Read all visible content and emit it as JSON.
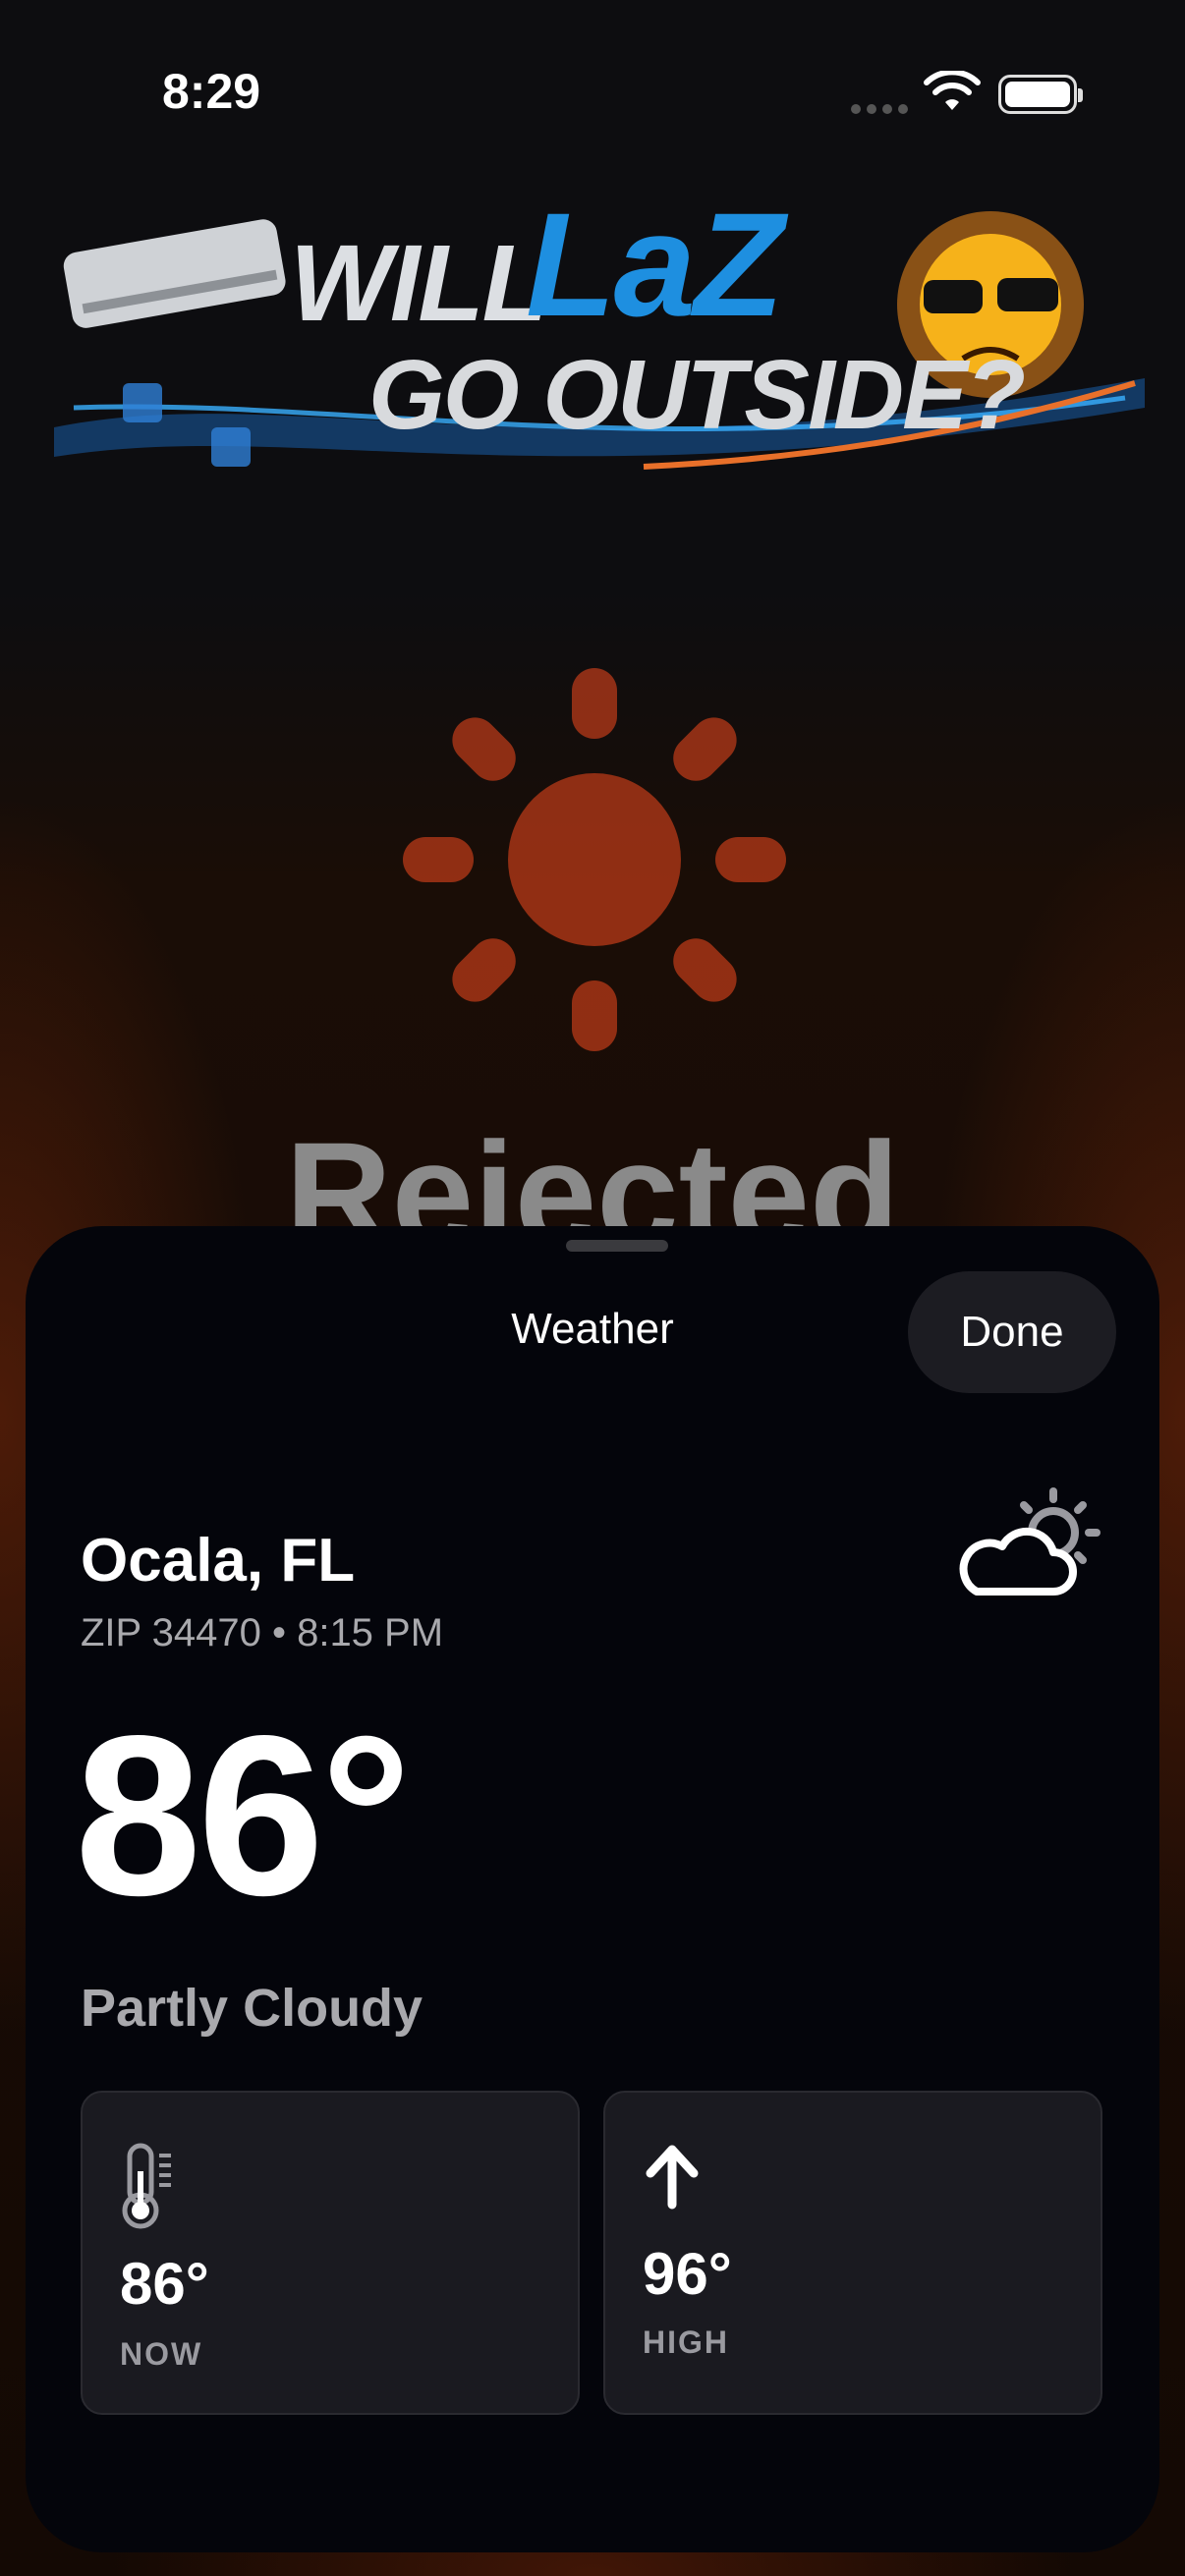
{
  "status_bar": {
    "time": "8:29"
  },
  "logo": {
    "line1a": "WILL",
    "line1b": "LaZ",
    "line2": "GO OUTSIDE?"
  },
  "verdict": {
    "text": "Rejected"
  },
  "sheet": {
    "title": "Weather",
    "done_label": "Done",
    "city": "Ocala, FL",
    "subtitle": "ZIP 34470 • 8:15 PM",
    "temperature": "86°",
    "condition": "Partly Cloudy",
    "condition_icon": "partly-cloudy-night-icon",
    "cards": [
      {
        "icon": "thermometer-icon",
        "value": "86°",
        "label": "NOW"
      },
      {
        "icon": "arrow-up-icon",
        "value": "96°",
        "label": "HIGH"
      }
    ]
  },
  "colors": {
    "sun": "#e0451c",
    "sheet_bg": "#04050b",
    "card_bg": "#1a1a20",
    "logo_blue": "#1e8fe0"
  }
}
